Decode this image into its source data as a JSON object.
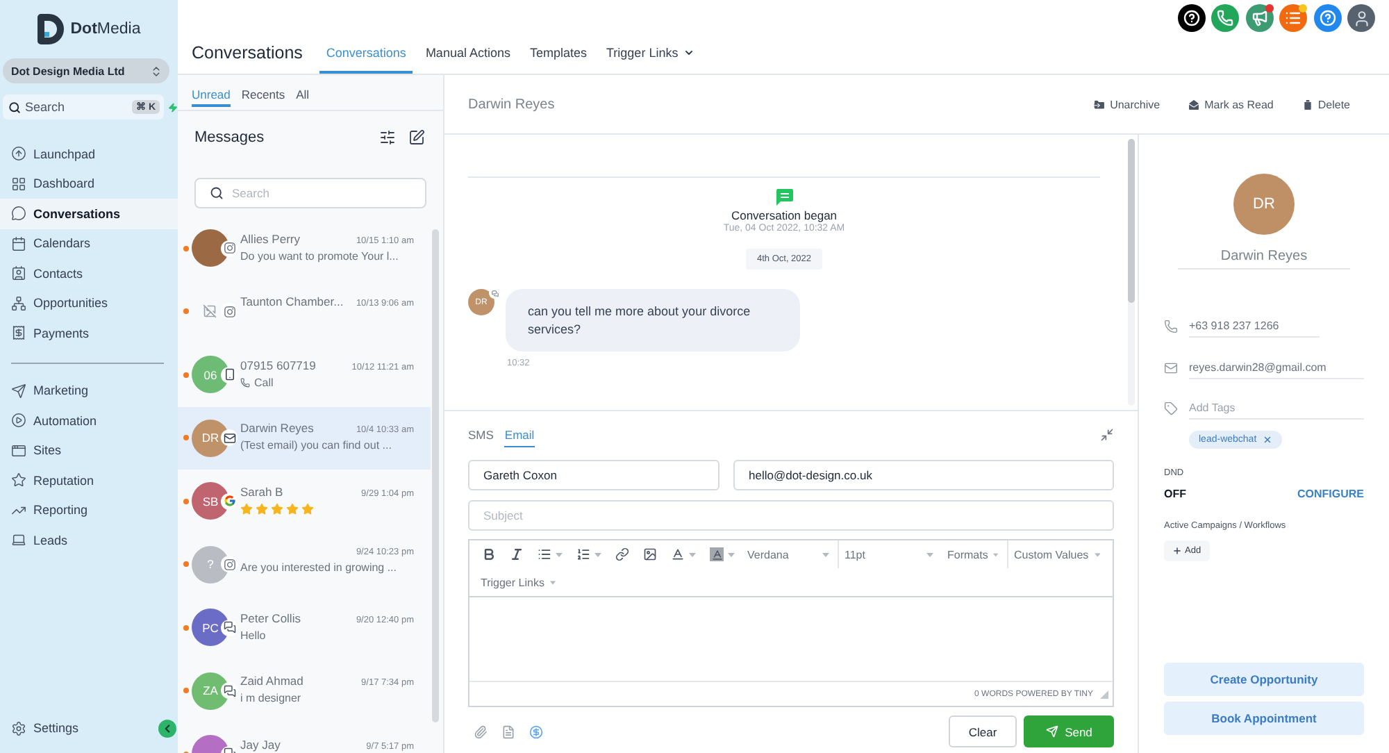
{
  "sidebar": {
    "logo": "**Dot**Media",
    "account": "Dot Design Media Ltd",
    "search": {
      "placeholder": "Search",
      "shortcut": "⌘ K"
    },
    "nav_groups": [
      {
        "items": [
          {
            "label": "Launchpad",
            "selected": false
          },
          {
            "label": "Dashboard",
            "selected": false
          },
          {
            "label": "Conversations",
            "selected": true
          },
          {
            "label": "Calendars",
            "selected": false
          },
          {
            "label": "Contacts",
            "selected": false
          },
          {
            "label": "Opportunities",
            "selected": false
          },
          {
            "label": "Payments",
            "selected": false
          }
        ]
      },
      {
        "items": [
          {
            "label": "Marketing",
            "selected": false
          },
          {
            "label": "Automation",
            "selected": false
          },
          {
            "label": "Sites",
            "selected": false
          },
          {
            "label": "Reputation",
            "selected": false
          },
          {
            "label": "Reporting",
            "selected": false
          },
          {
            "label": "Leads",
            "selected": false
          }
        ]
      }
    ],
    "settings": "Settings"
  },
  "header": {
    "title": "Conversations",
    "tabs": [
      {
        "label": "Conversations",
        "selected": true,
        "menu": false
      },
      {
        "label": "Manual Actions",
        "selected": false,
        "menu": false
      },
      {
        "label": "Templates",
        "selected": false,
        "menu": false
      },
      {
        "label": "Trigger Links",
        "selected": false,
        "menu": true
      }
    ],
    "top_actions": [
      {
        "color": "#000000",
        "badge": false
      },
      {
        "color": "#22a65a",
        "badge": false
      },
      {
        "color": "#3d9b74",
        "badge": true
      },
      {
        "color": "#f26a10",
        "badge": true
      },
      {
        "color": "#2188ee",
        "badge": false
      }
    ]
  },
  "conversations": {
    "tabs": [
      {
        "label": "Unread",
        "selected": true
      },
      {
        "label": "Recents",
        "selected": false
      },
      {
        "label": "All",
        "selected": false
      }
    ],
    "heading": "Messages",
    "search": {
      "placeholder": "Search"
    },
    "items": [
      {
        "name": "Allies Perry",
        "time": "10/15 1:10 am",
        "kind": "message",
        "preview": "Do you want to promote Your l...",
        "avatar": {
          "kind": "photo"
        },
        "channel": {
          "kind": "instagram"
        },
        "unread": true,
        "selected": false
      },
      {
        "name": "Taunton Chamber...",
        "time": "10/13 9:06 am",
        "kind": "message",
        "avatar": {
          "kind": "broken"
        },
        "channel": {
          "kind": "instagram"
        },
        "unread": true,
        "selected": false
      },
      {
        "name": "07915 607719",
        "time": "10/12 11:21 am",
        "kind": "call",
        "preview": "Call",
        "avatar": {
          "kind": "initials",
          "initials": "06",
          "color": "#6dbb74"
        },
        "channel": {
          "kind": "phone"
        },
        "unread": true,
        "selected": false
      },
      {
        "name": "Darwin Reyes",
        "time": "10/4 10:33 am",
        "kind": "message",
        "preview": "(Test email) you can find out ...",
        "avatar": {
          "kind": "initials",
          "initials": "DR",
          "color": "#c0926a"
        },
        "channel": {
          "kind": "email"
        },
        "unread": true,
        "selected": true
      },
      {
        "name": "Sarah B",
        "time": "9/29 1:04 pm",
        "kind": "review",
        "stars": 5,
        "avatar": {
          "kind": "initials",
          "initials": "SB",
          "color": "#c0646f"
        },
        "channel": {
          "kind": "google"
        },
        "unread": true,
        "selected": false
      },
      {
        "time": "9/24 10:23 pm",
        "kind": "message",
        "preview": "Are you interested in growing ...",
        "avatar": {
          "kind": "initials",
          "initials": "?",
          "color": "#b9bdc3"
        },
        "channel": {
          "kind": "instagram"
        },
        "unread": true,
        "selected": false
      },
      {
        "name": "Peter Collis",
        "time": "9/20 12:40 pm",
        "kind": "message",
        "preview": "Hello",
        "avatar": {
          "kind": "initials",
          "initials": "PC",
          "color": "#6a6cc6"
        },
        "channel": {
          "kind": "chat"
        },
        "unread": true,
        "selected": false
      },
      {
        "name": "Zaid Ahmad",
        "time": "9/17 7:34 pm",
        "kind": "message",
        "preview": "i m designer",
        "avatar": {
          "kind": "initials",
          "initials": "ZA",
          "color": "#70bd72"
        },
        "channel": {
          "kind": "chat"
        },
        "unread": true,
        "selected": false
      },
      {
        "name": "Jay Jay",
        "time": "9/7 5:17 pm",
        "kind": "message",
        "avatar": {
          "kind": "initials",
          "color": "#b46fc4"
        },
        "channel": {
          "kind": "chat"
        },
        "unread": true,
        "selected": false
      }
    ]
  },
  "thread": {
    "contact_name": "Darwin Reyes",
    "actions": [
      {
        "label": "Unarchive"
      },
      {
        "label": "Mark as Read"
      },
      {
        "label": "Delete"
      }
    ],
    "began": {
      "title": "Conversation began",
      "time": "Tue, 04 Oct 2022, 10:32 AM"
    },
    "date": "4th Oct, 2022",
    "messages": [
      {
        "initials": "DR",
        "text": "can you tell me more about your divorce services?",
        "time": "10:32"
      }
    ]
  },
  "composer": {
    "tabs": [
      {
        "label": "SMS",
        "selected": false
      },
      {
        "label": "Email",
        "selected": true
      }
    ],
    "from_name": "Gareth Coxon",
    "from_email": "hello@dot-design.co.uk",
    "subject_placeholder": "Subject",
    "toolbar": {
      "font": "Verdana",
      "size": "11pt",
      "menus": [
        "Formats",
        "Custom Values",
        "Trigger Links"
      ]
    },
    "status": "0 WORDS POWERED BY TINY",
    "buttons": [
      {
        "label": "Clear",
        "kind": "secondary"
      },
      {
        "label": "Send",
        "kind": "primary"
      }
    ]
  },
  "contact": {
    "initials": "DR",
    "name": "Darwin Reyes",
    "phone": "+63 918 237 1266",
    "email": "reyes.darwin28@gmail.com",
    "tags_placeholder": "Add Tags",
    "tags": [
      "lead-webchat"
    ],
    "dnd_label": "DND",
    "dnd_value": "OFF",
    "dnd_action": "CONFIGURE",
    "campaigns_label": "Active Campaigns / Workflows",
    "add_label": "Add",
    "buttons": [
      "Create Opportunity",
      "Book Appointment"
    ]
  }
}
